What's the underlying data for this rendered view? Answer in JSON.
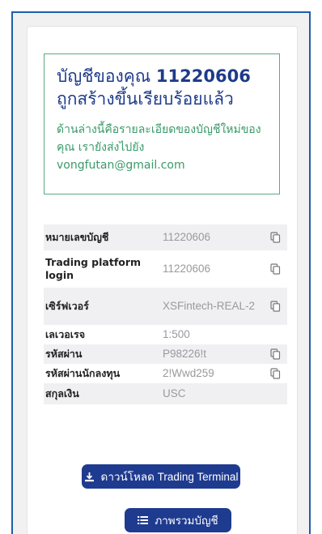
{
  "success": {
    "title_prefix": "บัญชีของคุณ",
    "account_number": "11220606",
    "title_suffix": "ถูกสร้างขึ้นเรียบร้อยแล้ว",
    "description": "ด้านล่างนี้คือรายละเอียดของบัญชีใหม่ของคุณ เรายังส่งไปยัง vongfutan@gmail.com"
  },
  "details": [
    {
      "label": "หมายเลขบัญชี",
      "value": "11220606",
      "copyable": true
    },
    {
      "label": "Trading platform login",
      "value": "11220606",
      "copyable": true
    },
    {
      "label": "เซิร์ฟเวอร์",
      "value": "XSFintech-REAL-2",
      "copyable": true
    },
    {
      "label": "เลเวอเรจ",
      "value": "1:500",
      "copyable": false
    },
    {
      "label": "รหัสผ่าน",
      "value": "P98226!t",
      "copyable": true
    },
    {
      "label": "รหัสผ่านนักลงทุน",
      "value": "2!Wwd259",
      "copyable": true
    },
    {
      "label": "สกุลเงิน",
      "value": "USC",
      "copyable": false
    }
  ],
  "actions": {
    "download_label": "ดาวน์โหลด Trading Terminal",
    "overview_label": "ภาพรวมบัญชี"
  },
  "colors": {
    "brand": "#1f3b8f",
    "success": "#3a9a68",
    "frame": "#1d5fa8"
  },
  "icons": {
    "copy": "copy-icon",
    "download": "download-icon",
    "list": "list-icon"
  }
}
